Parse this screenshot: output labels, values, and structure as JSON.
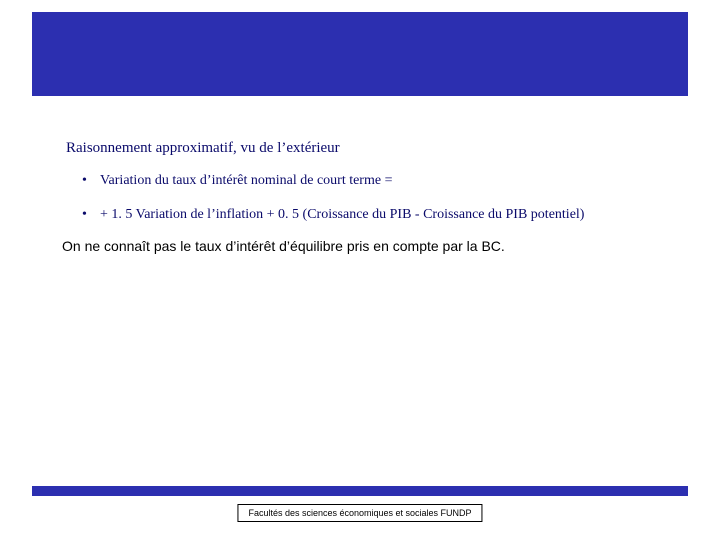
{
  "colors": {
    "accent": "#2c2fb0",
    "text_primary": "#0a0a6a",
    "text_body": "#000000"
  },
  "content": {
    "subtitle": "Raisonnement approximatif, vu de l’extérieur",
    "bullets": [
      "Variation du taux d’intérêt nominal de court terme =",
      "+ 1. 5 Variation de l’inflation + 0. 5 (Croissance du PIB - Croissance du PIB potentiel)"
    ],
    "note": "On ne connaît pas le taux d’intérêt d’équilibre pris en compte par la BC."
  },
  "footer": {
    "label": "Facultés des sciences économiques et sociales FUNDP"
  }
}
